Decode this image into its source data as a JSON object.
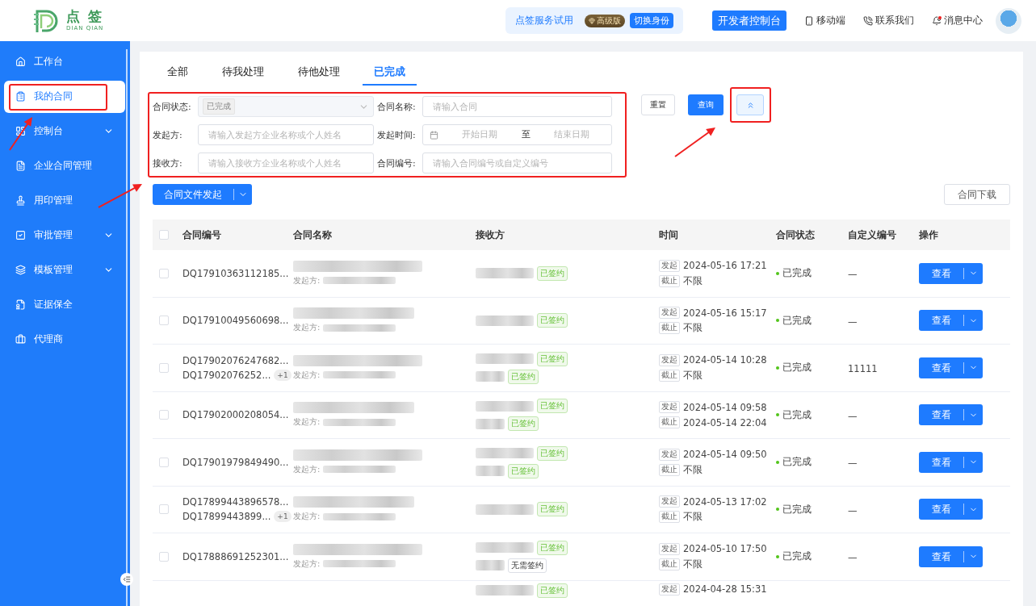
{
  "logo": {
    "name": "点 签",
    "pinyin": "DIAN QIAN"
  },
  "header": {
    "trial": {
      "label": "点签服务试用",
      "badge": "高级版",
      "button": "切换身份"
    },
    "dev_button": "开发者控制台",
    "links": [
      {
        "kind": "mobile",
        "label": "移动端"
      },
      {
        "kind": "contact",
        "label": "联系我们"
      },
      {
        "kind": "message",
        "label": "消息中心",
        "unread": true
      }
    ]
  },
  "sidebar": {
    "items": [
      {
        "kind": "home",
        "label": "工作台",
        "selected": false,
        "expandable": false,
        "highlighted": false
      },
      {
        "kind": "contract",
        "label": "我的合同",
        "selected": true,
        "expandable": false,
        "highlighted": true
      },
      {
        "kind": "console",
        "label": "控制台",
        "selected": false,
        "expandable": true,
        "highlighted": false
      },
      {
        "kind": "doc",
        "label": "企业合同管理",
        "selected": false,
        "expandable": false,
        "highlighted": false
      },
      {
        "kind": "seal",
        "label": "用印管理",
        "selected": false,
        "expandable": false,
        "highlighted": false
      },
      {
        "kind": "approve",
        "label": "审批管理",
        "selected": false,
        "expandable": true,
        "highlighted": false
      },
      {
        "kind": "template",
        "label": "模板管理",
        "selected": false,
        "expandable": true,
        "highlighted": false
      },
      {
        "kind": "evidence",
        "label": "证据保全",
        "selected": false,
        "expandable": false,
        "highlighted": false
      },
      {
        "kind": "agent",
        "label": "代理商",
        "selected": false,
        "expandable": false,
        "highlighted": false
      }
    ]
  },
  "tabs": [
    {
      "label": "全部",
      "selected": false
    },
    {
      "label": "待我处理",
      "selected": false
    },
    {
      "label": "待他处理",
      "selected": false
    },
    {
      "label": "已完成",
      "selected": true
    }
  ],
  "filters": {
    "highlighted": true,
    "fields": [
      {
        "kind": "select",
        "label": "合同状态:",
        "value": "已完成"
      },
      {
        "kind": "text",
        "label": "合同名称:",
        "placeholder": "请输入合同"
      },
      {
        "kind": "text",
        "label": "发起方:",
        "placeholder": "请输入发起方企业名称或个人姓名"
      },
      {
        "kind": "range",
        "label": "发起时间:",
        "start": "开始日期",
        "separator": "至",
        "end": "结束日期"
      },
      {
        "kind": "text",
        "label": "接收方:",
        "placeholder": "请输入接收方企业名称或个人姓名"
      },
      {
        "kind": "text",
        "label": "合同编号:",
        "placeholder": "请输入合同编号或自定义编号"
      }
    ],
    "reset": "重置",
    "query": "查询",
    "collapse_highlighted": true
  },
  "actions": {
    "create": "合同文件发起",
    "download": "合同下载"
  },
  "table": {
    "all_checked": false,
    "columns": [
      "合同编号",
      "合同名称",
      "接收方",
      "时间",
      "合同状态",
      "自定义编号",
      "操作"
    ],
    "rows": [
      {
        "checked": false,
        "ids": [
          "DQ17910363112185..."
        ],
        "sender_label": "发起方:",
        "receivers": [
          {
            "kind": "signed",
            "tag": "已签约"
          }
        ],
        "start_tag": "发起",
        "start": "2024-05-16 17:21",
        "end_tag": "截止",
        "end": "不限",
        "status": "已完成",
        "custom": "—",
        "action": "查看"
      },
      {
        "checked": false,
        "ids": [
          "DQ17910049560698..."
        ],
        "sender_label": "发起方:",
        "receivers": [
          {
            "kind": "signed",
            "tag": "已签约"
          }
        ],
        "start_tag": "发起",
        "start": "2024-05-16 15:17",
        "end_tag": "截止",
        "end": "不限",
        "status": "已完成",
        "custom": "—",
        "action": "查看"
      },
      {
        "checked": false,
        "ids": [
          "DQ17902076247682...",
          "DQ17902076252..."
        ],
        "more": "+1",
        "sender_label": "发起方:",
        "receivers": [
          {
            "kind": "signed",
            "tag": "已签约"
          },
          {
            "kind": "signed",
            "tag": "已签约"
          }
        ],
        "start_tag": "发起",
        "start": "2024-05-14 10:28",
        "end_tag": "截止",
        "end": "不限",
        "status": "已完成",
        "custom": "11111",
        "action": "查看"
      },
      {
        "checked": false,
        "ids": [
          "DQ17902000208054..."
        ],
        "sender_label": "发起方:",
        "receivers": [
          {
            "kind": "signed",
            "tag": "已签约"
          },
          {
            "kind": "signed",
            "tag": "已签约"
          }
        ],
        "start_tag": "发起",
        "start": "2024-05-14 09:58",
        "end_tag": "截止",
        "end": "2024-05-14 22:04",
        "status": "已完成",
        "custom": "—",
        "action": "查看"
      },
      {
        "checked": false,
        "ids": [
          "DQ17901979849490..."
        ],
        "sender_label": "发起方:",
        "receivers": [
          {
            "kind": "signed",
            "tag": "已签约"
          },
          {
            "kind": "signed",
            "tag": "已签约"
          }
        ],
        "start_tag": "发起",
        "start": "2024-05-14 09:50",
        "end_tag": "截止",
        "end": "不限",
        "status": "已完成",
        "custom": "—",
        "action": "查看"
      },
      {
        "checked": false,
        "ids": [
          "DQ17899443896578...",
          "DQ17899443899..."
        ],
        "more": "+1",
        "sender_label": "发起方:",
        "receivers": [
          {
            "kind": "signed",
            "tag": "已签约"
          }
        ],
        "start_tag": "发起",
        "start": "2024-05-13 17:02",
        "end_tag": "截止",
        "end": "不限",
        "status": "已完成",
        "custom": "—",
        "action": "查看"
      },
      {
        "checked": false,
        "ids": [
          "DQ17888691252301..."
        ],
        "sender_label": "发起方:",
        "receivers": [
          {
            "kind": "signed",
            "tag": "已签约"
          },
          {
            "kind": "none",
            "tag": "无需签约"
          }
        ],
        "start_tag": "发起",
        "start": "2024-05-10 17:50",
        "end_tag": "截止",
        "end": "不限",
        "status": "已完成",
        "custom": "—",
        "action": "查看"
      },
      {
        "ids": [],
        "receivers": [
          {
            "kind": "signed",
            "tag": "已签约"
          }
        ],
        "start_tag": "发起",
        "start": "2024-04-28 15:31"
      }
    ]
  }
}
